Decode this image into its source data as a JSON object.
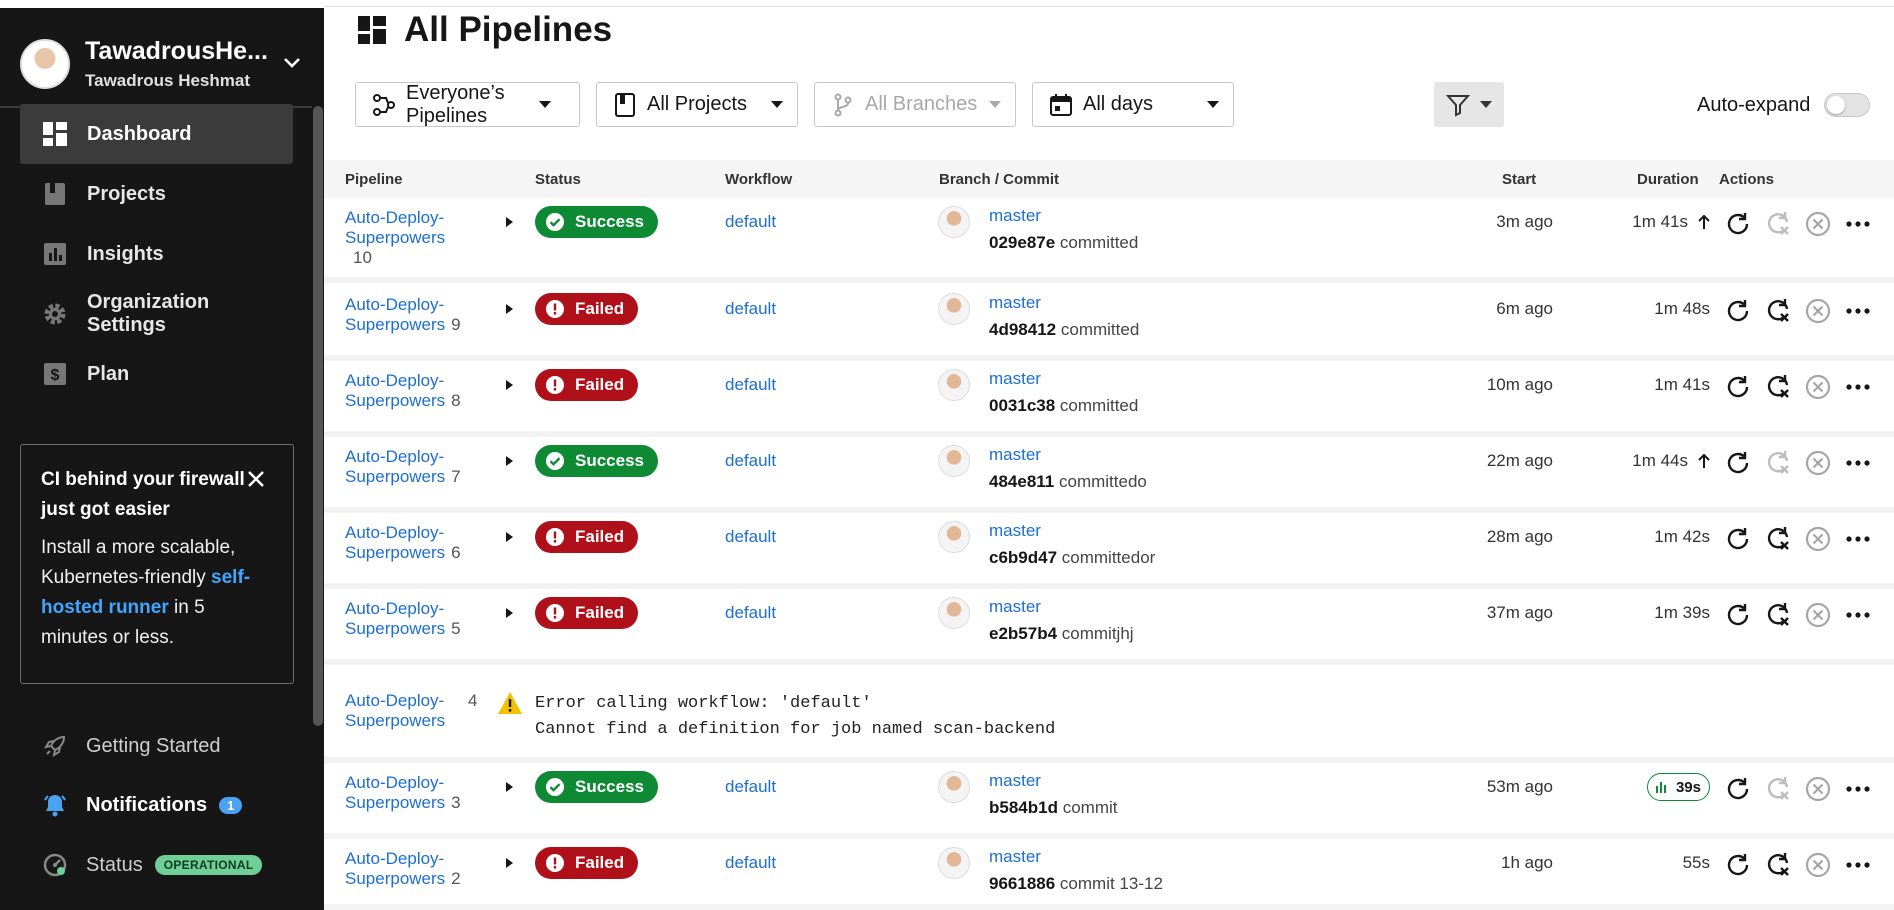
{
  "user": {
    "name": "TawadrousHe...",
    "subtitle": "Tawadrous Heshmat"
  },
  "sidebar": {
    "items": [
      {
        "label": "Dashboard",
        "icon": "dashboard-icon",
        "active": true
      },
      {
        "label": "Projects",
        "icon": "projects-icon"
      },
      {
        "label": "Insights",
        "icon": "insights-icon"
      },
      {
        "label": "Organization Settings",
        "icon": "gear-icon"
      },
      {
        "label": "Plan",
        "icon": "dollar-icon"
      }
    ],
    "promo": {
      "title": "CI behind your firewall just got easier",
      "body_prefix": "Install a more scalable, Kubernetes-friendly ",
      "link": "self-hosted runner",
      "body_suffix": " in 5 minutes or less."
    },
    "getting_started": "Getting Started",
    "notifications": "Notifications",
    "notifications_count": "1",
    "status": "Status",
    "status_badge": "OPERATIONAL"
  },
  "page": {
    "title": "All Pipelines"
  },
  "filters": {
    "pipelines": "Everyone’s Pipelines",
    "projects": "All Projects",
    "branches": "All Branches",
    "days": "All days",
    "auto_expand": "Auto-expand"
  },
  "columns": [
    "Pipeline",
    "Status",
    "Workflow",
    "Branch / Commit",
    "Start",
    "Duration",
    "Actions"
  ],
  "colors": {
    "success": "#0e8a35",
    "failed": "#b0101a",
    "link": "#1c6fd1",
    "sidebar": "#161616"
  },
  "rows": [
    {
      "pipeline_a": "Auto-Deploy-",
      "pipeline_b": "Superpowers",
      "number": "10",
      "status": "Success",
      "workflow": "default",
      "branch": "master",
      "sha": "029e87e",
      "message": "committed",
      "start": "3m ago",
      "duration": "1m 41s",
      "duration_up": true
    },
    {
      "pipeline_a": "Auto-Deploy-",
      "pipeline_b": "Superpowers",
      "number": "9",
      "status": "Failed",
      "workflow": "default",
      "branch": "master",
      "sha": "4d98412",
      "message": "committed",
      "start": "6m ago",
      "duration": "1m 48s"
    },
    {
      "pipeline_a": "Auto-Deploy-",
      "pipeline_b": "Superpowers",
      "number": "8",
      "status": "Failed",
      "workflow": "default",
      "branch": "master",
      "sha": "0031c38",
      "message": "committed",
      "start": "10m ago",
      "duration": "1m 41s"
    },
    {
      "pipeline_a": "Auto-Deploy-",
      "pipeline_b": "Superpowers",
      "number": "7",
      "status": "Success",
      "workflow": "default",
      "branch": "master",
      "sha": "484e811",
      "message": "committedo",
      "start": "22m ago",
      "duration": "1m 44s",
      "duration_up": true
    },
    {
      "pipeline_a": "Auto-Deploy-",
      "pipeline_b": "Superpowers",
      "number": "6",
      "status": "Failed",
      "workflow": "default",
      "branch": "master",
      "sha": "c6b9d47",
      "message": "committedor",
      "start": "28m ago",
      "duration": "1m 42s"
    },
    {
      "pipeline_a": "Auto-Deploy-",
      "pipeline_b": "Superpowers",
      "number": "5",
      "status": "Failed",
      "workflow": "default",
      "branch": "master",
      "sha": "e2b57b4",
      "message": "commitjhj",
      "start": "37m ago",
      "duration": "1m 39s"
    },
    {
      "pipeline_a": "Auto-Deploy-",
      "pipeline_b": "Superpowers",
      "number": "4",
      "error": true,
      "error_line1": "Error calling workflow: 'default'",
      "error_line2": "Cannot find a definition for job named scan-backend"
    },
    {
      "pipeline_a": "Auto-Deploy-",
      "pipeline_b": "Superpowers",
      "number": "3",
      "status": "Success",
      "workflow": "default",
      "branch": "master",
      "sha": "b584b1d",
      "message": "commit",
      "start": "53m ago",
      "duration": "39s",
      "duration_badge": true
    },
    {
      "pipeline_a": "Auto-Deploy-",
      "pipeline_b": "Superpowers",
      "number": "2",
      "status": "Failed",
      "workflow": "default",
      "branch": "master",
      "sha": "9661886",
      "message": "commit 13-12",
      "start": "1h ago",
      "duration": "55s"
    }
  ]
}
